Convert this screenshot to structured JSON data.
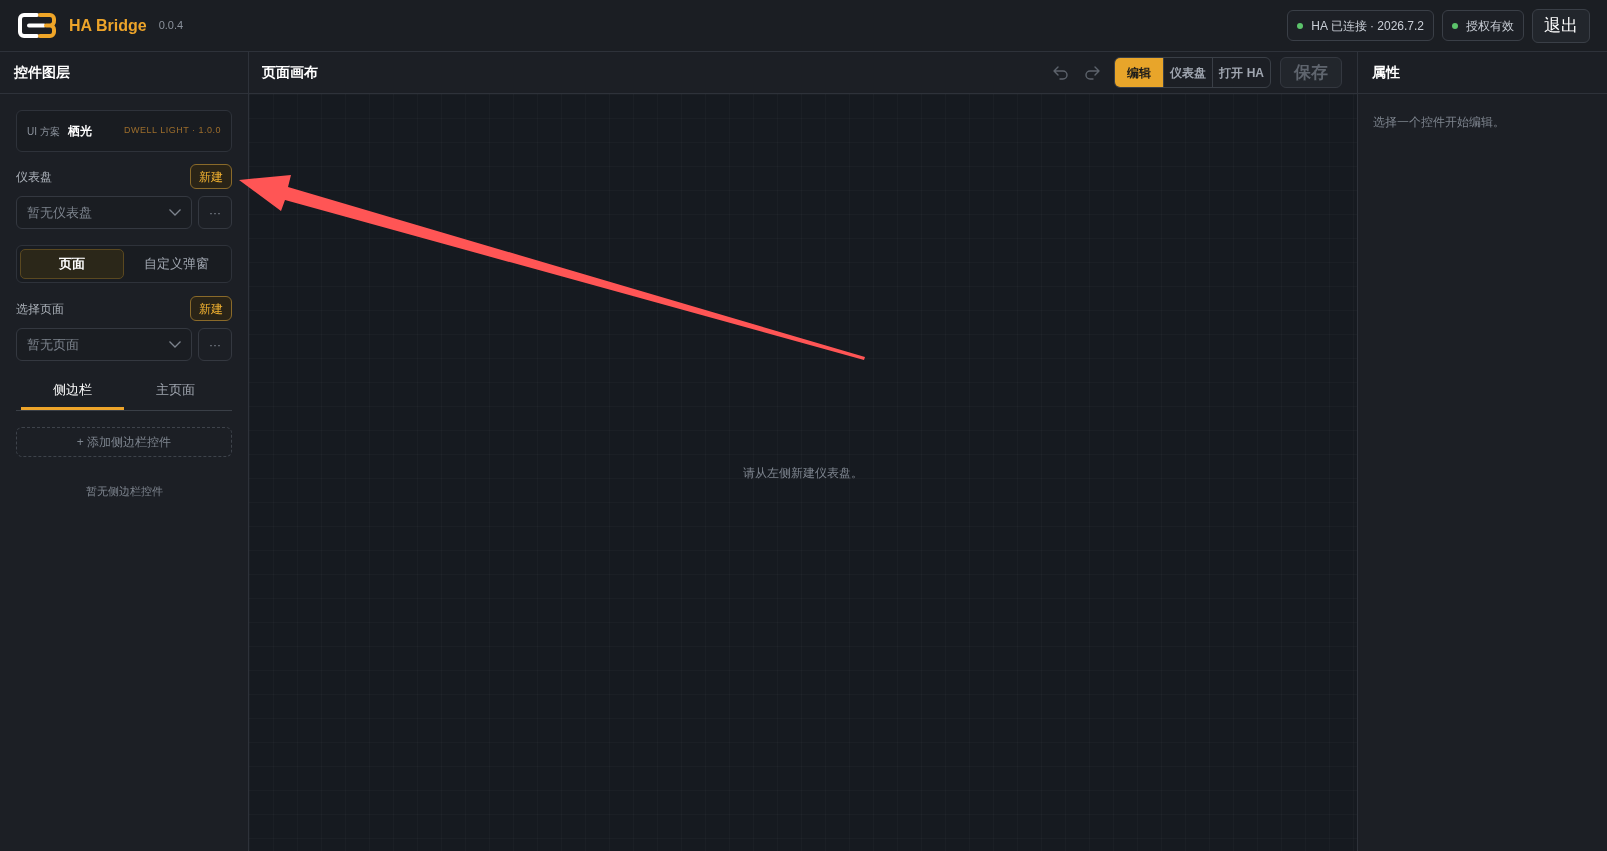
{
  "header": {
    "app_name": "HA Bridge",
    "version": "0.0.4",
    "status_chips": [
      {
        "label": "HA 已连接 · 2026.7.2",
        "color": "#5cc36b"
      },
      {
        "label": "授权有效",
        "color": "#5cc36b"
      }
    ],
    "logout_button": "退出"
  },
  "layers_panel": {
    "title": "控件图层",
    "ui_scheme": {
      "label": "UI 方案",
      "name": "栖光",
      "meta": "DWELL LIGHT · 1.0.0"
    },
    "dashboard": {
      "label": "仪表盘",
      "new_button": "新建",
      "select": {
        "placeholder": "暂无仪表盘"
      },
      "more_button": "···"
    },
    "mode_tabs": [
      {
        "label": "页面",
        "selected": true
      },
      {
        "label": "自定义弹窗",
        "selected": false
      }
    ],
    "page": {
      "label": "选择页面",
      "new_button": "新建",
      "select": {
        "placeholder": "暂无页面"
      },
      "more_button": "···"
    },
    "area_tabs": [
      {
        "label": "侧边栏",
        "selected": true
      },
      {
        "label": "主页面",
        "selected": false
      }
    ],
    "add_button": "+ 添加侧边栏控件",
    "empty_text": "暂无侧边栏控件"
  },
  "canvas_panel": {
    "title": "页面画布",
    "undo": {
      "disabled": true
    },
    "redo": {
      "disabled": true
    },
    "view_tabs": [
      {
        "label": "编辑",
        "selected": true
      },
      {
        "label": "仪表盘",
        "selected": false
      },
      {
        "label": "打开 HA",
        "selected": false
      }
    ],
    "save_button": {
      "label": "保存",
      "disabled": true
    },
    "empty_text": "请从左侧新建仪表盘。"
  },
  "properties_panel": {
    "title": "属性",
    "empty_text": "选择一个控件开始编辑。"
  },
  "overlay": {
    "kind": "arrow"
  }
}
